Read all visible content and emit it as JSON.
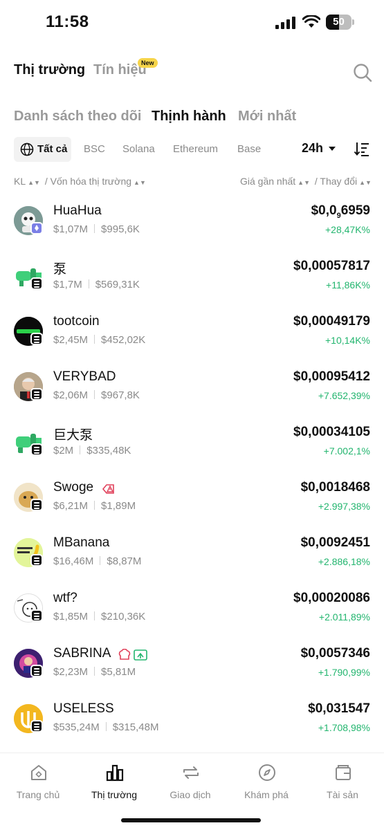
{
  "status_bar": {
    "time": "11:58",
    "battery": "50",
    "battery_level": 0.5
  },
  "header": {
    "tabs": [
      {
        "label": "Thị trường",
        "active": true
      },
      {
        "label": "Tín hiệu",
        "active": false
      }
    ],
    "new_badge": "New"
  },
  "sub_tabs": [
    {
      "label": "Danh sách theo dõi",
      "active": false
    },
    {
      "label": "Thịnh hành",
      "active": true
    },
    {
      "label": "Mới nhất",
      "active": false
    }
  ],
  "chains": {
    "all": "Tất cả",
    "items": [
      "BSC",
      "Solana",
      "Ethereum",
      "Base"
    ]
  },
  "interval": "24h",
  "columns": {
    "left_a": "KL",
    "left_sep": "/",
    "left_b": "Vốn hóa thị trường",
    "right_a": "Giá gần nhất",
    "right_sep": "/",
    "right_b": "Thay đổi"
  },
  "tokens": [
    {
      "name": "HuaHua",
      "volume": "$1,07M",
      "mcap": "$995,6K",
      "price_main": "$0,0",
      "price_sub": "9",
      "price_tail": "6959",
      "change": "+28,47K%",
      "chain": "ethereum"
    },
    {
      "name": "泵",
      "volume": "$1,7M",
      "mcap": "$569,31K",
      "price": "$0,00057817",
      "change": "+11,86K%",
      "chain": "solana"
    },
    {
      "name": "tootcoin",
      "volume": "$2,45M",
      "mcap": "$452,02K",
      "price": "$0,00049179",
      "change": "+10,14K%",
      "chain": "solana"
    },
    {
      "name": "VERYBAD",
      "volume": "$2,06M",
      "mcap": "$967,8K",
      "price": "$0,00095412",
      "change": "+7.652,39%",
      "chain": "solana"
    },
    {
      "name": "巨大泵",
      "volume": "$2M",
      "mcap": "$335,48K",
      "price": "$0,00034105",
      "change": "+7.002,1%",
      "chain": "solana"
    },
    {
      "name": "Swoge",
      "volume": "$6,21M",
      "mcap": "$1,89M",
      "price": "$0,0018468",
      "change": "+2.997,38%",
      "chain": "solana"
    },
    {
      "name": "MBanana",
      "volume": "$16,46M",
      "mcap": "$8,87M",
      "price": "$0,0092451",
      "change": "+2.886,18%",
      "chain": "solana"
    },
    {
      "name": "wtf?",
      "volume": "$1,85M",
      "mcap": "$210,36K",
      "price": "$0,00020086",
      "change": "+2.011,89%",
      "chain": "solana"
    },
    {
      "name": "SABRINA",
      "volume": "$2,23M",
      "mcap": "$5,81M",
      "price": "$0,0057346",
      "change": "+1.790,99%",
      "chain": "solana"
    },
    {
      "name": "USELESS",
      "volume": "$535,24M",
      "mcap": "$315,48M",
      "price": "$0,031547",
      "change": "+1.708,98%",
      "chain": "solana"
    }
  ],
  "bottom_nav": [
    {
      "label": "Trang chủ",
      "icon": "home-icon",
      "active": false
    },
    {
      "label": "Thị trường",
      "icon": "chart-icon",
      "active": true
    },
    {
      "label": "Giao dịch",
      "icon": "trade-icon",
      "active": false
    },
    {
      "label": "Khám phá",
      "icon": "compass-icon",
      "active": false
    },
    {
      "label": "Tài sản",
      "icon": "wallet-icon",
      "active": false
    }
  ],
  "colors": {
    "positive": "#22b56e",
    "badge": "#f7d54a",
    "muted": "#8a8a8a"
  }
}
